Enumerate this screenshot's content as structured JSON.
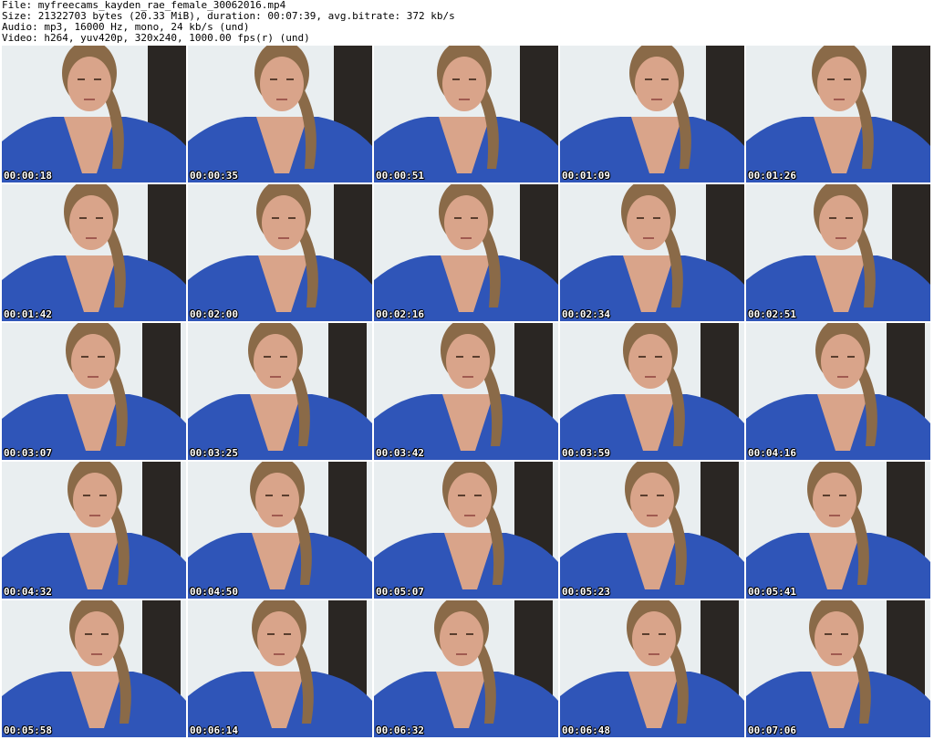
{
  "header": {
    "file_line": "File: myfreecams_kayden_rae_female_30062016.mp4",
    "size_line": "Size: 21322703 bytes (20.33 MiB), duration: 00:07:39, avg.bitrate: 372 kb/s",
    "audio_line": "Audio: mp3, 16000 Hz, mono, 24 kb/s (und)",
    "video_line": "Video: h264, yuv420p, 320x240, 1000.00 fps(r) (und)"
  },
  "thumbnails": [
    {
      "timestamp": "00:00:18"
    },
    {
      "timestamp": "00:00:35"
    },
    {
      "timestamp": "00:00:51"
    },
    {
      "timestamp": "00:01:09"
    },
    {
      "timestamp": "00:01:26"
    },
    {
      "timestamp": "00:01:42"
    },
    {
      "timestamp": "00:02:00"
    },
    {
      "timestamp": "00:02:16"
    },
    {
      "timestamp": "00:02:34"
    },
    {
      "timestamp": "00:02:51"
    },
    {
      "timestamp": "00:03:07"
    },
    {
      "timestamp": "00:03:25"
    },
    {
      "timestamp": "00:03:42"
    },
    {
      "timestamp": "00:03:59"
    },
    {
      "timestamp": "00:04:16"
    },
    {
      "timestamp": "00:04:32"
    },
    {
      "timestamp": "00:04:50"
    },
    {
      "timestamp": "00:05:07"
    },
    {
      "timestamp": "00:05:23"
    },
    {
      "timestamp": "00:05:41"
    },
    {
      "timestamp": "00:05:58"
    },
    {
      "timestamp": "00:06:14"
    },
    {
      "timestamp": "00:06:32"
    },
    {
      "timestamp": "00:06:48"
    },
    {
      "timestamp": "00:07:06"
    }
  ],
  "colors": {
    "wall": "#e9eef0",
    "dark_panel": "#2a2623",
    "shirt": "#2f55b8",
    "skin": "#d9a48a",
    "hair": "#8a6a48",
    "timestamp_text": "#ffffff"
  }
}
